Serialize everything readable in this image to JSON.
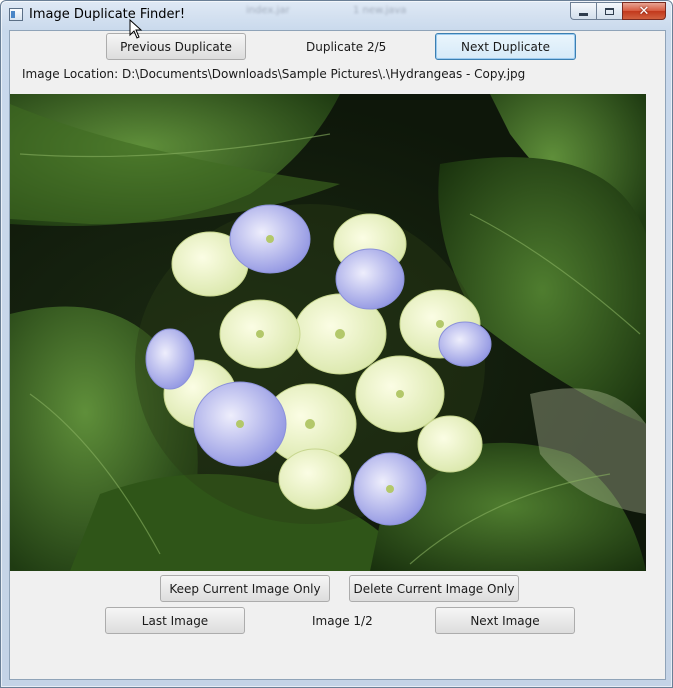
{
  "window": {
    "title": "Image Duplicate Finder!",
    "ghost_text_1": "index.jar",
    "ghost_text_2": "1 new.java"
  },
  "top": {
    "previous_duplicate_label": "Previous Duplicate",
    "duplicate_counter": "Duplicate 2/5",
    "next_duplicate_label": "Next Duplicate",
    "image_location": "Image Location: D:\\Documents\\Downloads\\Sample Pictures\\.\\Hydrangeas - Copy.jpg"
  },
  "bottom": {
    "keep_label": "Keep Current Image Only",
    "delete_label": "Delete Current Image Only",
    "last_image_label": "Last Image",
    "image_counter": "Image 1/2",
    "next_image_label": "Next Image"
  },
  "colors": {
    "focus_border": "#3c7fb1",
    "close_red": "#c2381c",
    "client_bg": "#f0f0f0"
  },
  "icons": [
    "app-icon",
    "minimize-icon",
    "maximize-icon",
    "close-icon",
    "cursor-icon"
  ]
}
